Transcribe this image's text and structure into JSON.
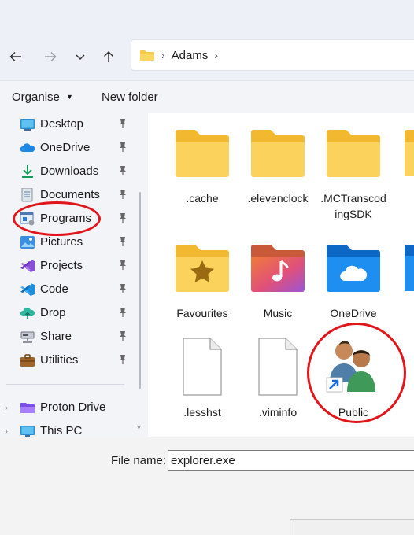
{
  "address": {
    "crumb": "Adams"
  },
  "toolbar": {
    "organise": "Organise",
    "new_folder": "New folder"
  },
  "nav": {
    "quick": [
      {
        "label": "Desktop",
        "icon": "desktop-icon"
      },
      {
        "label": "OneDrive",
        "icon": "onedrive-icon"
      },
      {
        "label": "Downloads",
        "icon": "download-icon"
      },
      {
        "label": "Documents",
        "icon": "documents-icon"
      },
      {
        "label": "Programs",
        "icon": "programs-icon"
      },
      {
        "label": "Pictures",
        "icon": "pictures-icon"
      },
      {
        "label": "Projects",
        "icon": "visual-studio-icon"
      },
      {
        "label": "Code",
        "icon": "vscode-icon"
      },
      {
        "label": "Drop",
        "icon": "cloud-upload-icon"
      },
      {
        "label": "Share",
        "icon": "share-drive-icon"
      },
      {
        "label": "Utilities",
        "icon": "briefcase-icon"
      }
    ],
    "drives": [
      {
        "label": "Proton Drive",
        "icon": "proton-drive-icon"
      },
      {
        "label": "This PC",
        "icon": "this-pc-icon"
      }
    ]
  },
  "files": [
    {
      "name": ".cache",
      "icon": "folder-icon"
    },
    {
      "name": ".elevenclock",
      "icon": "folder-icon"
    },
    {
      "name": ".MCTranscodingSDK",
      "icon": "folder-icon"
    },
    {
      "name": "Favourites",
      "icon": "favourites-folder-icon"
    },
    {
      "name": "Music",
      "icon": "music-folder-icon"
    },
    {
      "name": "OneDrive",
      "icon": "onedrive-folder-icon"
    },
    {
      "name": ".lesshst",
      "icon": "blank-file-icon"
    },
    {
      "name": ".viminfo",
      "icon": "blank-file-icon"
    },
    {
      "name": "Public",
      "icon": "public-users-icon"
    }
  ],
  "filename": {
    "label": "File name:",
    "value": "explorer.exe"
  },
  "colors": {
    "folder": "#f7c948",
    "accent": "#0067c0",
    "annotation": "#e0161b"
  }
}
